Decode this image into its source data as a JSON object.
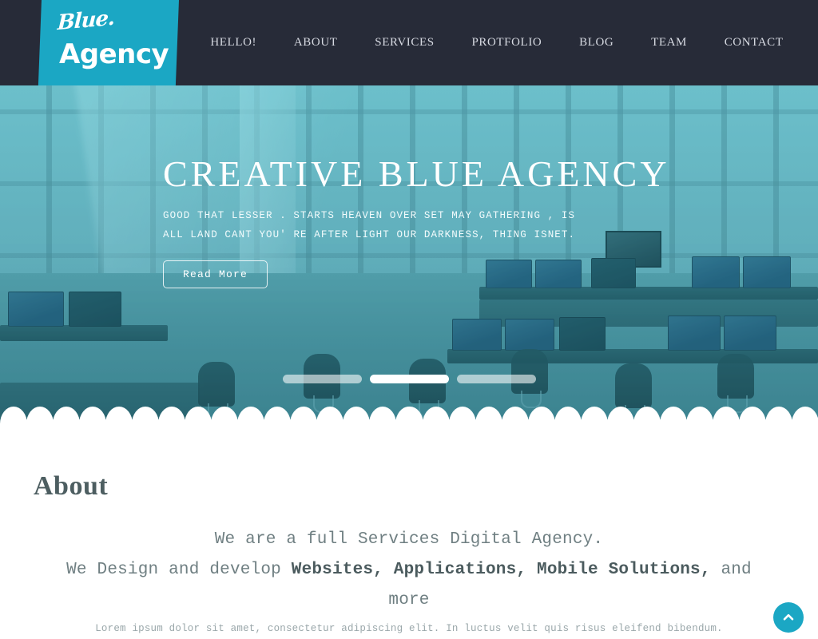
{
  "brand": {
    "script_word": "Blue.",
    "bold_word": "Agency",
    "accent_color": "#1ba7c4",
    "navbar_color": "#272b38"
  },
  "nav": {
    "items": [
      {
        "label": "HELLO!"
      },
      {
        "label": "ABOUT"
      },
      {
        "label": "SERVICES"
      },
      {
        "label": "PROTFOLIO"
      },
      {
        "label": "BLOG"
      },
      {
        "label": "TEAM"
      },
      {
        "label": "CONTACT"
      }
    ]
  },
  "hero": {
    "title": "CREATIVE BLUE AGENCY",
    "subtitle_line1": "GOOD THAT LESSER .  STARTS HEAVEN OVER SET MAY GATHERING ,  IS ALL LAND CANT",
    "subtitle_line2": "YOU' RE AFTER LIGHT OUR DARKNESS,  THING ISNET.",
    "cta_label": "Read More",
    "slides": [
      {
        "active": false
      },
      {
        "active": true
      },
      {
        "active": false
      }
    ]
  },
  "about": {
    "heading": "About",
    "lead_part1": "We are a full Services Digital Agency.",
    "lead_part2": "We Design and develop ",
    "lead_bold": "Websites, Applications, Mobile Solutions,",
    "lead_part3": " and more",
    "note": "Lorem ipsum dolor sit amet, consectetur adipiscing elit. In luctus velit quis risus eleifend bibendum."
  },
  "scroll_top": {
    "icon": "chevron-up-icon",
    "label": "Back to top"
  }
}
